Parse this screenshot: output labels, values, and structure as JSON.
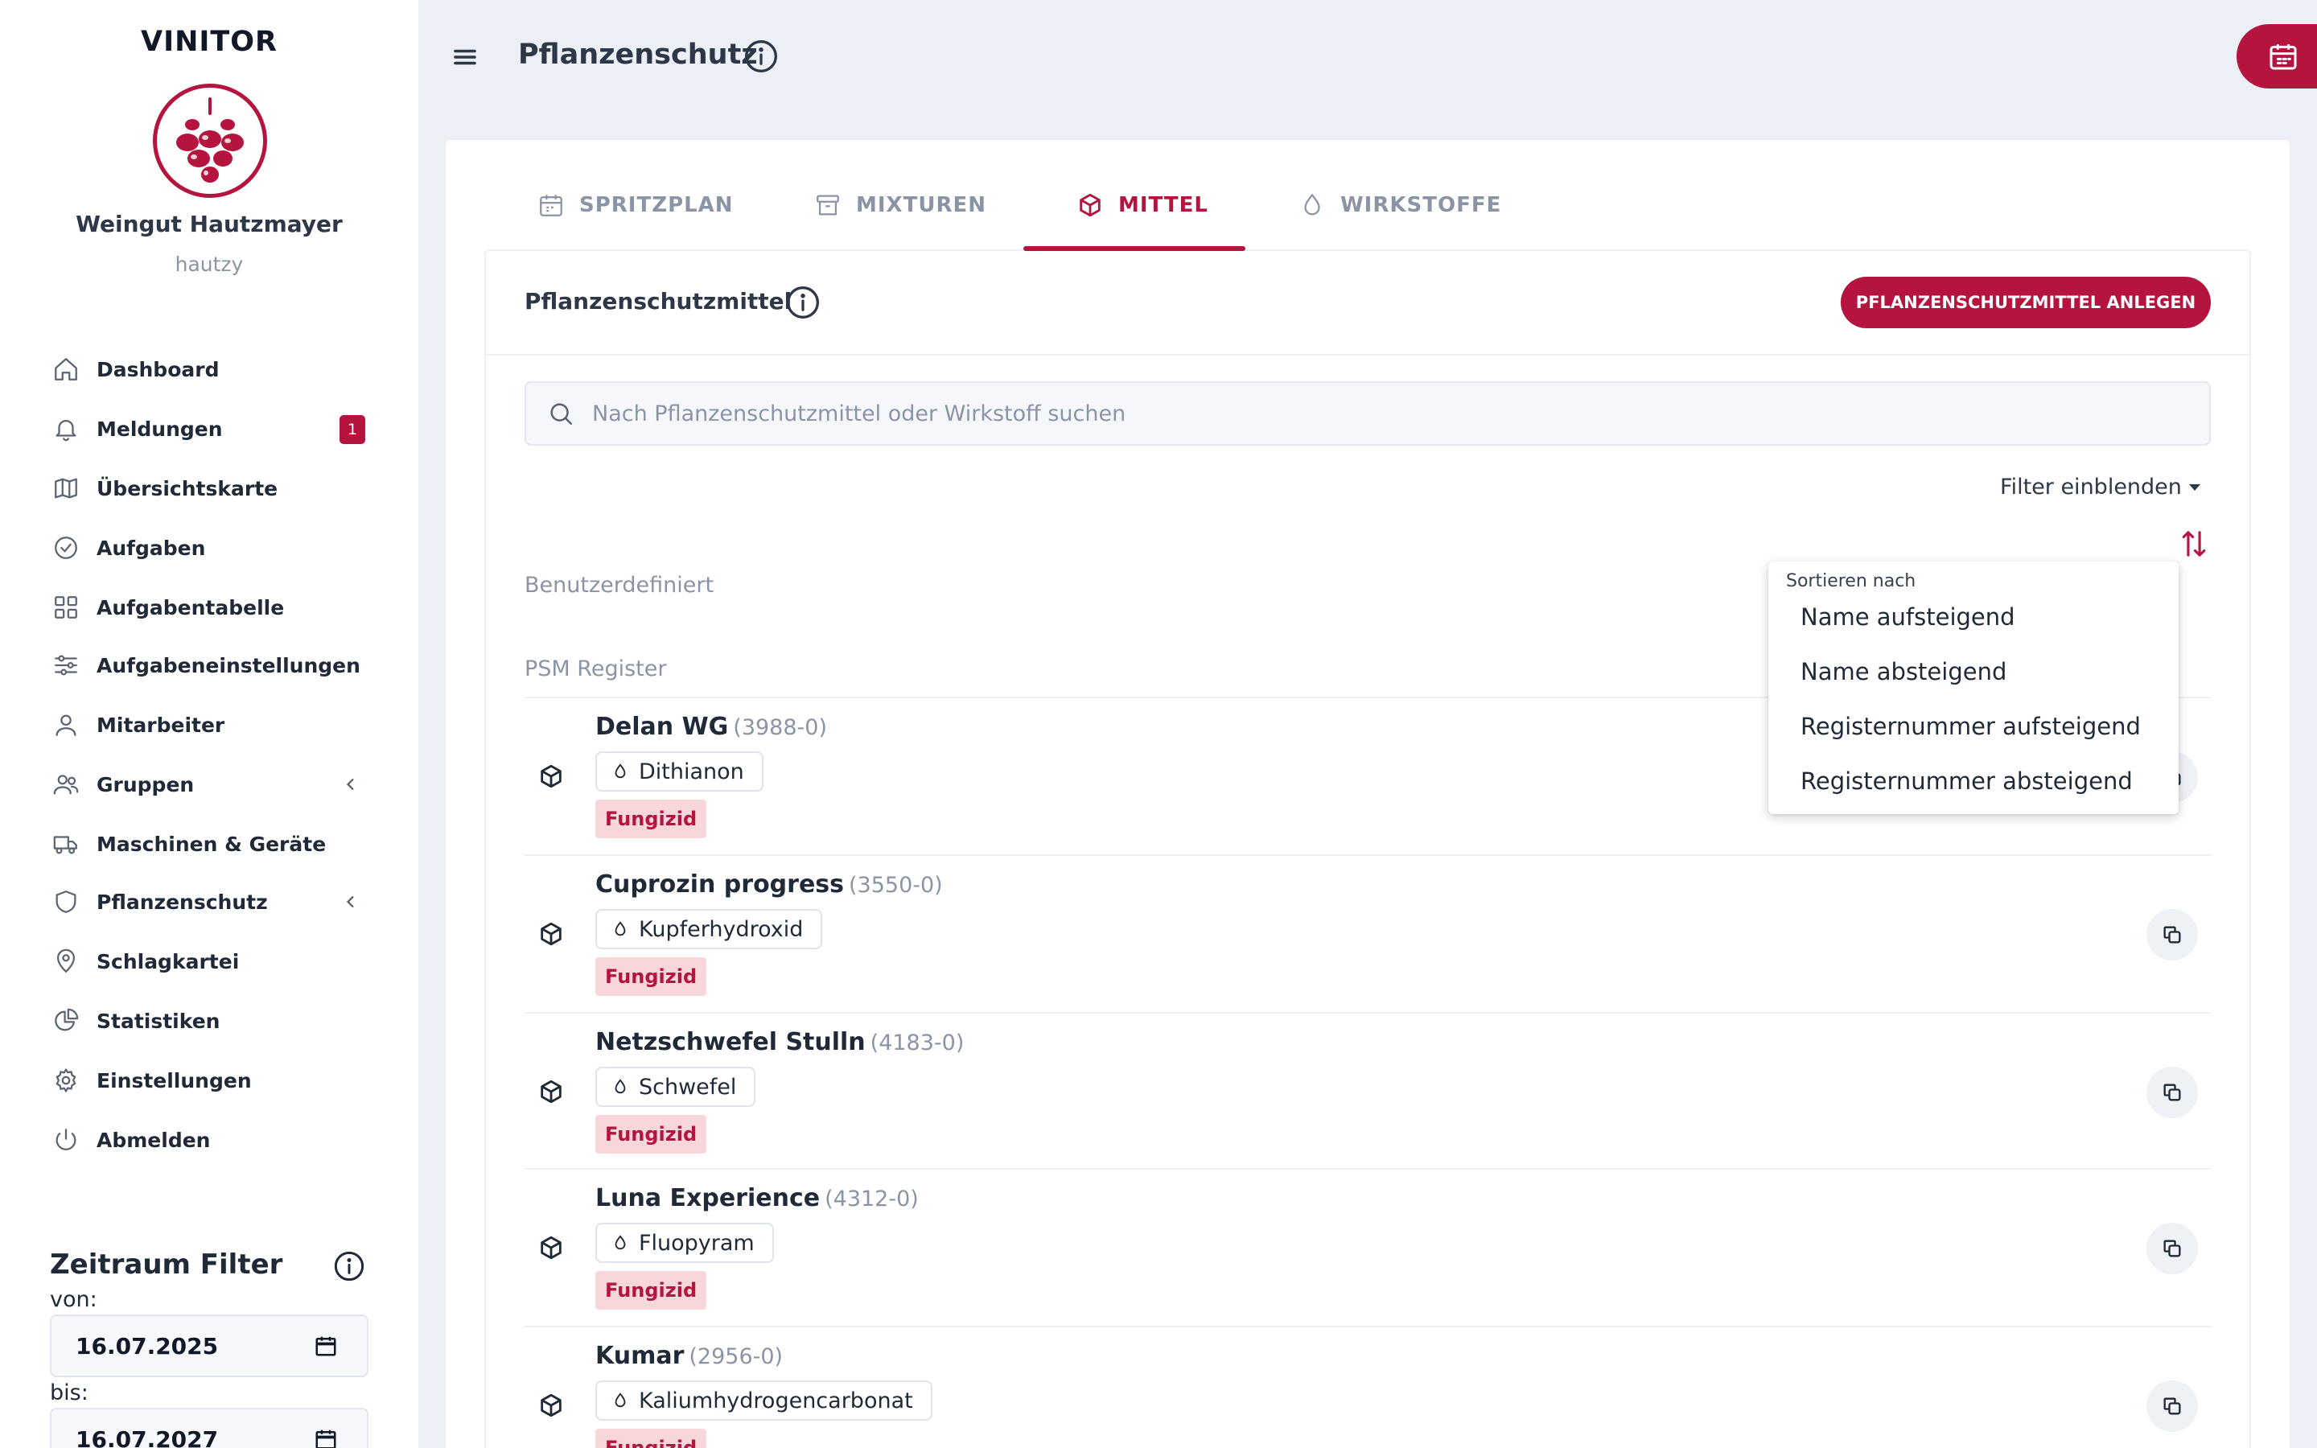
{
  "app": {
    "brand": "VINITOR",
    "org_name": "Weingut Hautzmayer",
    "org_user": "hautzy"
  },
  "sidebar": {
    "items": [
      {
        "label": "Dashboard",
        "icon": "home-icon"
      },
      {
        "label": "Meldungen",
        "icon": "bell-icon",
        "badge": "1"
      },
      {
        "label": "Übersichtskarte",
        "icon": "map-icon"
      },
      {
        "label": "Aufgaben",
        "icon": "check-circle-icon"
      },
      {
        "label": "Aufgabentabelle",
        "icon": "grid-icon"
      },
      {
        "label": "Aufgabeneinstellungen",
        "icon": "sliders-icon"
      },
      {
        "label": "Mitarbeiter",
        "icon": "user-icon"
      },
      {
        "label": "Gruppen",
        "icon": "users-icon"
      },
      {
        "label": "Maschinen & Geräte",
        "icon": "truck-icon"
      },
      {
        "label": "Pflanzenschutz",
        "icon": "shield-icon"
      },
      {
        "label": "Schlagkartei",
        "icon": "map-pin-icon"
      },
      {
        "label": "Statistiken",
        "icon": "pie-chart-icon"
      },
      {
        "label": "Einstellungen",
        "icon": "gear-icon"
      },
      {
        "label": "Abmelden",
        "icon": "power-icon"
      }
    ]
  },
  "date_filter": {
    "title": "Zeitraum Filter",
    "from_label": "von:",
    "from_value": "16.07.2025",
    "to_label": "bis:",
    "to_value": "16.07.2027"
  },
  "header": {
    "title": "Pflanzenschutz"
  },
  "tabs": [
    {
      "label": "SPRITZPLAN",
      "icon": "calendar-icon",
      "active": false
    },
    {
      "label": "MIXTUREN",
      "icon": "archive-icon",
      "active": false
    },
    {
      "label": "MITTEL",
      "icon": "cube-icon",
      "active": true
    },
    {
      "label": "WIRKSTOFFE",
      "icon": "droplet-icon",
      "active": false
    }
  ],
  "section": {
    "title": "Pflanzenschutzmittel",
    "create_button": "PFLANZENSCHUTZMITTEL ANLEGEN",
    "search_placeholder": "Nach Pflanzenschutzmittel oder Wirkstoff suchen",
    "filter_toggle": "Filter einblenden",
    "group_custom": "Benutzerdefiniert",
    "group_register": "PSM Register"
  },
  "products": [
    {
      "name": "Delan WG",
      "reg": "(3988-0)",
      "substance": "Dithianon",
      "type": "Fungizid"
    },
    {
      "name": "Cuprozin progress",
      "reg": "(3550-0)",
      "substance": "Kupferhydroxid",
      "type": "Fungizid"
    },
    {
      "name": "Netzschwefel Stulln",
      "reg": "(4183-0)",
      "substance": "Schwefel",
      "type": "Fungizid"
    },
    {
      "name": "Luna Experience",
      "reg": "(4312-0)",
      "substance": "Fluopyram",
      "type": "Fungizid"
    },
    {
      "name": "Kumar",
      "reg": "(2956-0)",
      "substance": "Kaliumhydrogencarbonat",
      "type": "Fungizid"
    }
  ],
  "sort_menu": {
    "heading": "Sortieren nach",
    "options": [
      "Name aufsteigend",
      "Name absteigend",
      "Registernummer aufsteigend",
      "Registernummer absteigend"
    ]
  },
  "colors": {
    "accent": "#b5143f",
    "tag_bg": "#f8d7da",
    "muted_text": "#8a94a6",
    "page_bg": "#eceff5"
  }
}
